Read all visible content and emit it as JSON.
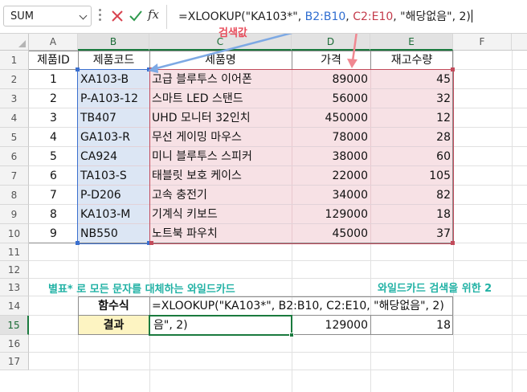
{
  "formula_bar": {
    "name_box": "SUM",
    "fx": "fx",
    "formula_parts": [
      "=XLOOKUP(\"",
      "KA103*",
      "\", ",
      "B2:B10",
      ", ",
      "C2:E10",
      ", \"해당없음\", 2)"
    ]
  },
  "columns": [
    "A",
    "B",
    "C",
    "D",
    "E",
    "F"
  ],
  "rows": [
    "1",
    "2",
    "3",
    "4",
    "5",
    "6",
    "7",
    "8",
    "9",
    "10",
    "11",
    "12",
    "13",
    "14",
    "15",
    "16",
    "17"
  ],
  "table": {
    "headers": [
      "제품ID",
      "제품코드",
      "제품명",
      "가격",
      "재고수량"
    ],
    "rows": [
      [
        "1",
        "XA103-B",
        "고급 블루투스 이어폰",
        "89000",
        "45"
      ],
      [
        "2",
        "P-A103-12",
        "스마트 LED 스탠드",
        "56000",
        "32"
      ],
      [
        "3",
        "TB407",
        "UHD 모니터 32인치",
        "450000",
        "12"
      ],
      [
        "4",
        "GA103-R",
        "무선 게이밍 마우스",
        "78000",
        "28"
      ],
      [
        "5",
        "CA924",
        "미니 블루투스 스피커",
        "38000",
        "60"
      ],
      [
        "6",
        "TA103-S",
        "태블릿 보호 케이스",
        "22000",
        "105"
      ],
      [
        "7",
        "P-D206",
        "고속 충전기",
        "34000",
        "82"
      ],
      [
        "8",
        "KA103-M",
        "기계식 키보드",
        "129000",
        "18"
      ],
      [
        "9",
        "NB550",
        "노트북 파우치",
        "45000",
        "37"
      ]
    ]
  },
  "summary": {
    "func_label": "함수식",
    "func_text": "=XLOOKUP(\"KA103*\", B2:B10, C2:E10, \"해당없음\", 2)",
    "result_label": "결과",
    "result_cells": [
      "음\", 2)",
      "129000",
      "18"
    ]
  },
  "annotations": {
    "lookup_value": "검색값",
    "wildcard_note": "별표* 로 모든 문자를 대체하는 와일드카드",
    "wildcard_mode": "와일드카드 검색을 위한 2"
  },
  "colors": {
    "blue_range": "#3a6fcf",
    "red_range": "#c24b5b",
    "active_green": "#1a7a3e",
    "annotation_red": "#e84b5a",
    "annotation_teal": "#22b2a5"
  }
}
